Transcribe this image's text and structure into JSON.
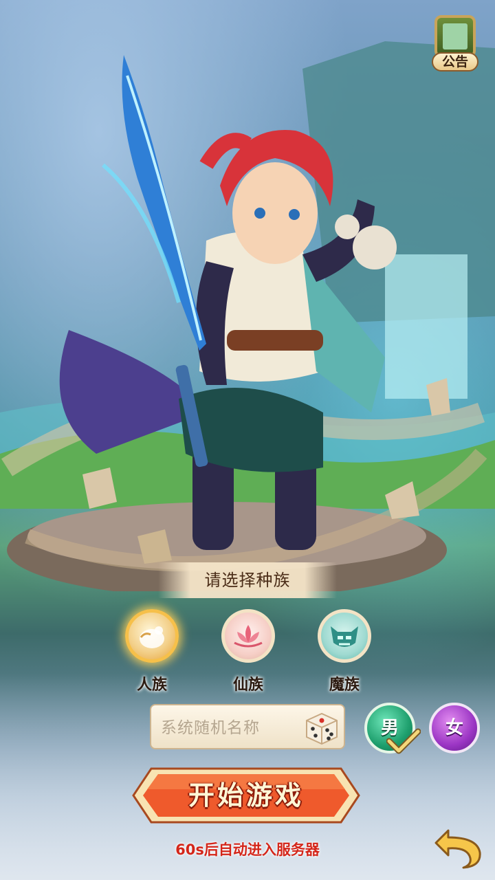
{
  "notice": {
    "label": "公告",
    "icon": "scroll-icon"
  },
  "race_select": {
    "title": "请选择种族",
    "options": [
      {
        "label": "人族",
        "icon": "human-race-icon",
        "selected": true
      },
      {
        "label": "仙族",
        "icon": "lotus-icon",
        "selected": false
      },
      {
        "label": "魔族",
        "icon": "demon-mask-icon",
        "selected": false
      }
    ]
  },
  "name_input": {
    "placeholder": "系统随机名称",
    "dice_icon": "dice-icon"
  },
  "gender": {
    "male": {
      "label": "男",
      "selected": true
    },
    "female": {
      "label": "女",
      "selected": false
    }
  },
  "start_button": {
    "label": "开始游戏"
  },
  "countdown": {
    "text": "60s后自动进入服务器"
  },
  "colors": {
    "accent": "#e9502b",
    "gold": "#f6c04a",
    "countdown": "#d4261a"
  }
}
